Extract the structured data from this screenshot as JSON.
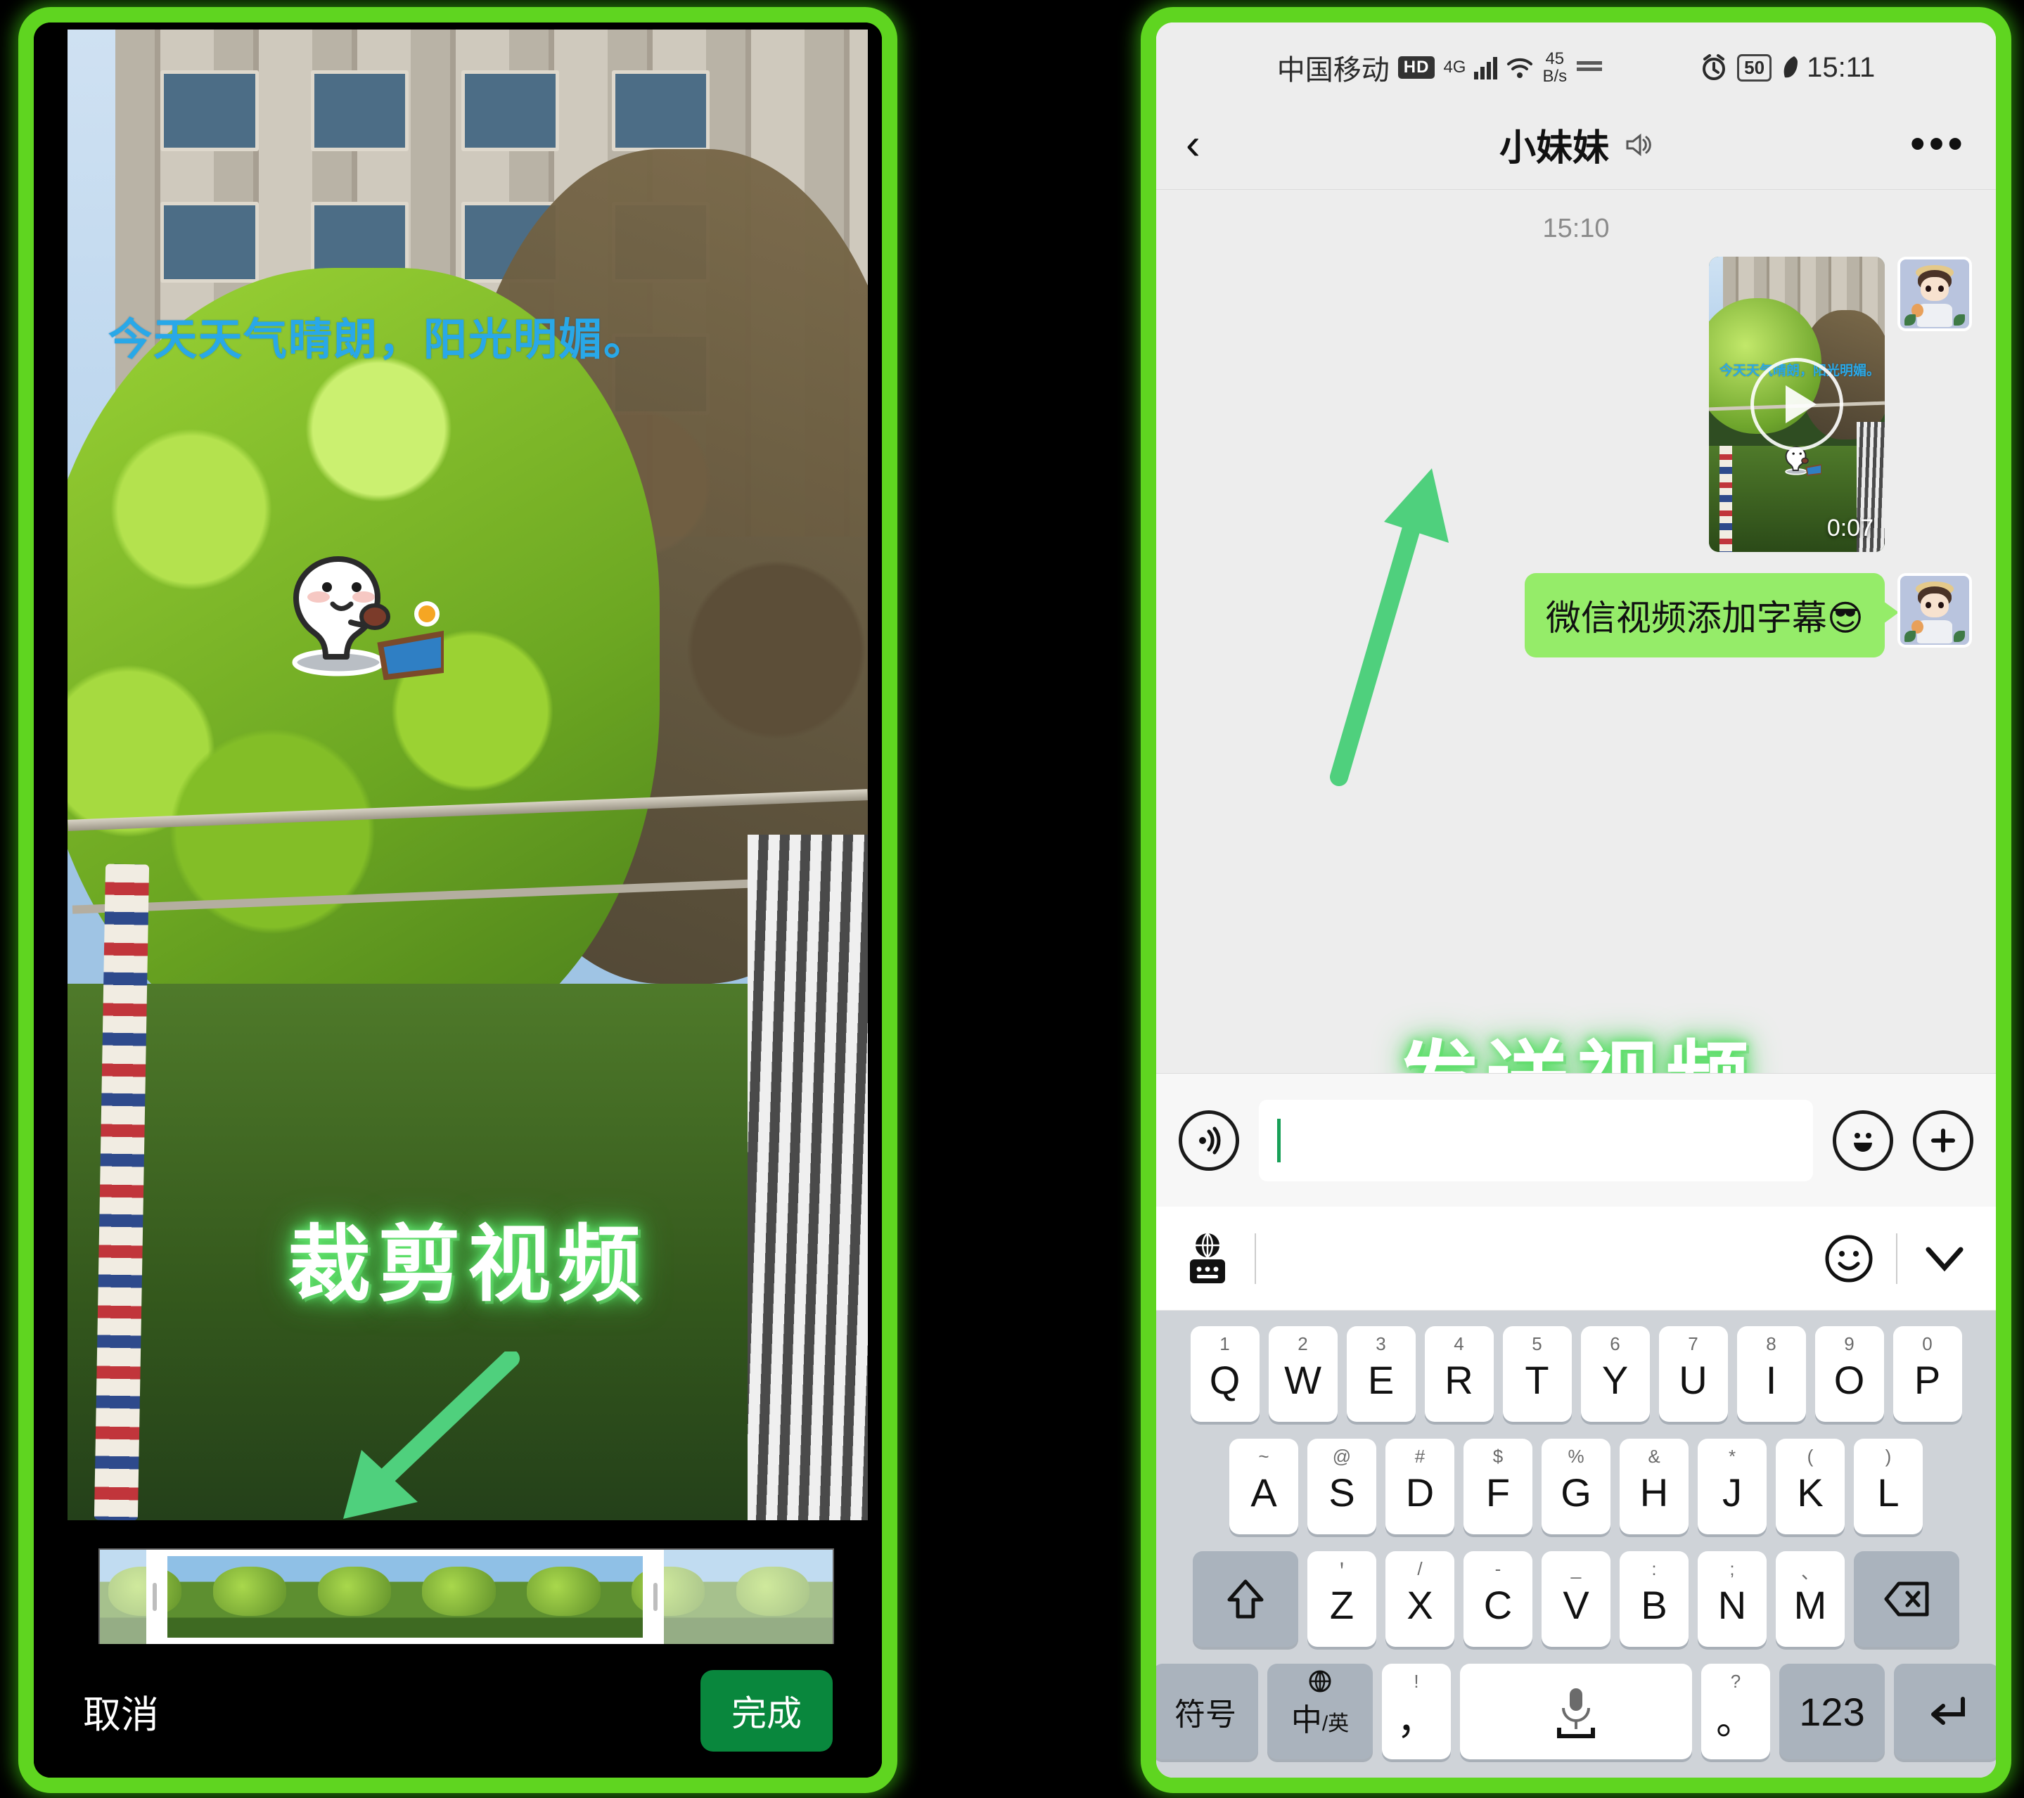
{
  "editor": {
    "subtitle_text": "今天天气晴朗，阳光明媚。",
    "overlay_label": "裁剪视频",
    "cancel_label": "取消",
    "done_label": "完成",
    "sticker_name": "ping-pong-sticker",
    "subtitle_color": "#29a8e8",
    "done_color": "#09873d"
  },
  "phone": {
    "statusbar": {
      "carrier": "中国移动",
      "hd": "HD",
      "network": "4G",
      "speed_value": "45",
      "speed_unit": "B/s",
      "battery": "50",
      "clock": "15:11"
    },
    "navbar": {
      "back_icon": "chevron-left-icon",
      "title": "小妹妹",
      "mute_icon": "mute-speaker-icon",
      "more_icon": "more-horizontal-icon"
    },
    "chat": {
      "timestamp": "15:10",
      "video_message": {
        "duration": "0:07",
        "subtitle": "今天天气晴朗，阳光明媚。",
        "play_icon": "play-icon"
      },
      "text_message": "微信视频添加字幕😎",
      "overlay_label": "发送视频"
    },
    "inputbar": {
      "voice_icon": "voice-wave-icon",
      "input_value": "",
      "input_placeholder": "",
      "emoji_icon": "emoji-smile-icon",
      "plus_icon": "plus-circle-icon"
    },
    "candidatebar": {
      "ime_icon": "globe-keyboard-icon",
      "emoji_icon": "emoji-outline-icon",
      "collapse_icon": "chevron-down-icon"
    },
    "keyboard": {
      "row1": [
        {
          "sup": "1",
          "main": "Q"
        },
        {
          "sup": "2",
          "main": "W"
        },
        {
          "sup": "3",
          "main": "E"
        },
        {
          "sup": "4",
          "main": "R"
        },
        {
          "sup": "5",
          "main": "T"
        },
        {
          "sup": "6",
          "main": "Y"
        },
        {
          "sup": "7",
          "main": "U"
        },
        {
          "sup": "8",
          "main": "I"
        },
        {
          "sup": "9",
          "main": "O"
        },
        {
          "sup": "0",
          "main": "P"
        }
      ],
      "row2": [
        {
          "sup": "~",
          "main": "A"
        },
        {
          "sup": "@",
          "main": "S"
        },
        {
          "sup": "#",
          "main": "D"
        },
        {
          "sup": "$",
          "main": "F"
        },
        {
          "sup": "%",
          "main": "G"
        },
        {
          "sup": "&",
          "main": "H"
        },
        {
          "sup": "*",
          "main": "J"
        },
        {
          "sup": "(",
          "main": "K"
        },
        {
          "sup": ")",
          "main": "L"
        }
      ],
      "row3": [
        {
          "sup": "＇",
          "main": "Z"
        },
        {
          "sup": "/",
          "main": "X"
        },
        {
          "sup": "-",
          "main": "C"
        },
        {
          "sup": "_",
          "main": "V"
        },
        {
          "sup": ":",
          "main": "B"
        },
        {
          "sup": ";",
          "main": "N"
        },
        {
          "sup": "、",
          "main": "M"
        }
      ],
      "shift_icon": "shift-arrow-icon",
      "backspace_icon": "backspace-icon",
      "symbol_key": "符号",
      "lang_key_cn": "中",
      "lang_key_en": "英",
      "lang_globe_icon": "globe-icon",
      "comma_key": {
        "sup": "!",
        "main": "，"
      },
      "space_key": {
        "icon": "microphone-icon",
        "label": "space-bar"
      },
      "period_key": {
        "sup": "?",
        "main": "。"
      },
      "num_key": "123",
      "enter_icon": "enter-return-icon"
    }
  },
  "frame_color": "#5fd520"
}
